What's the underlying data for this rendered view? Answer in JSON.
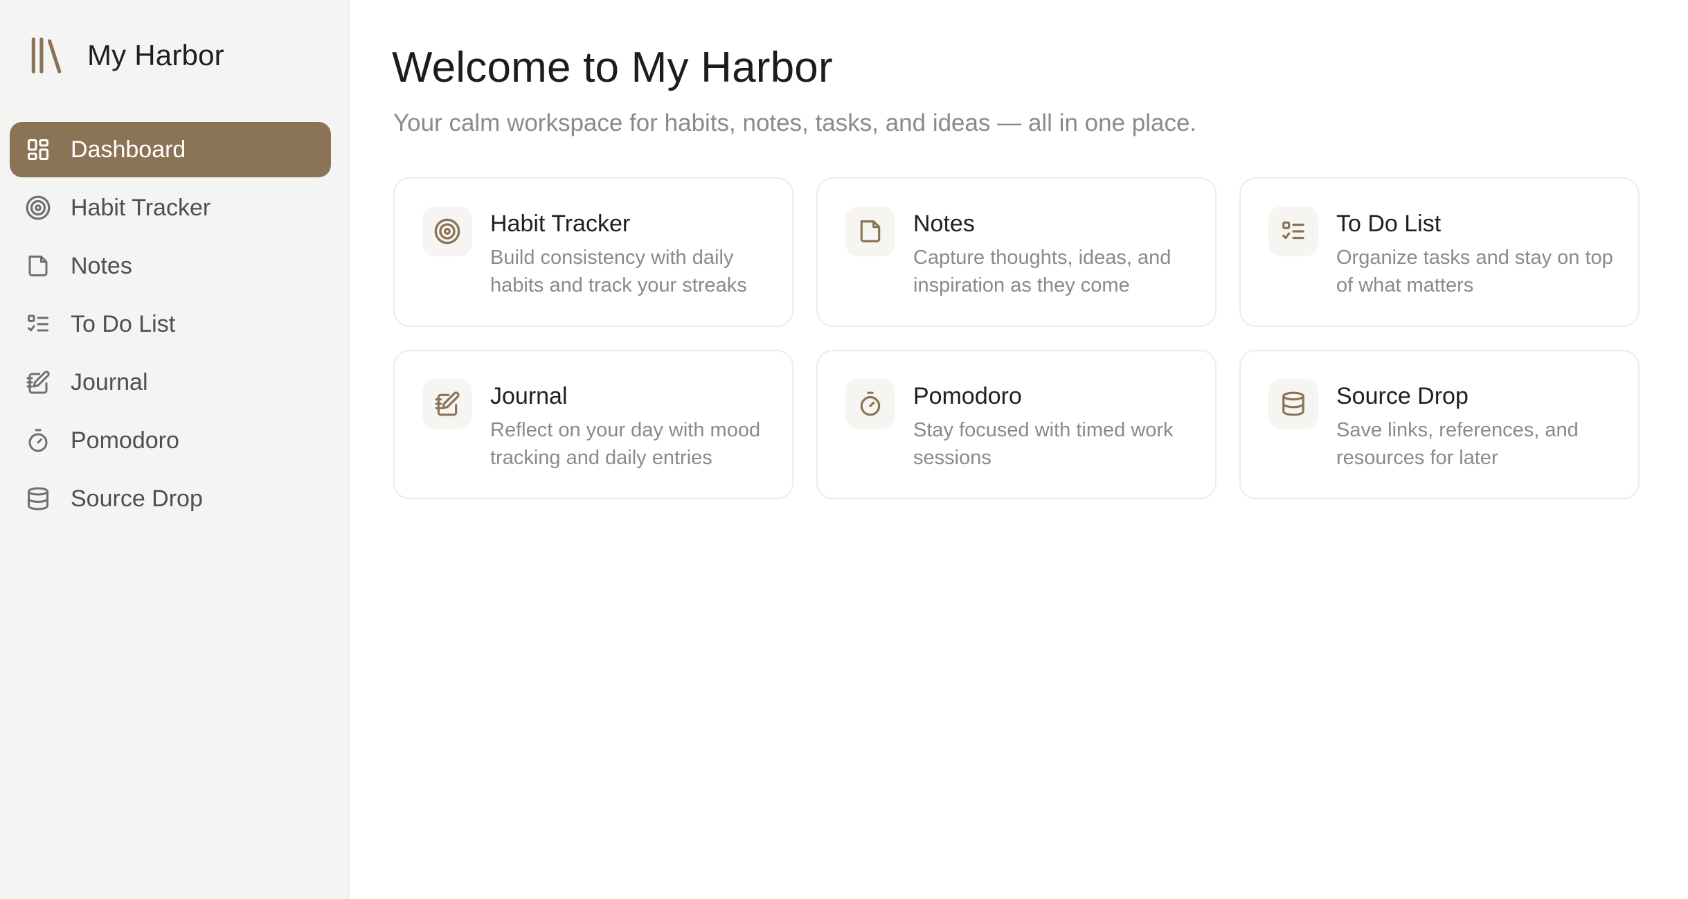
{
  "app": {
    "name": "My Harbor",
    "logo_icon": "library-icon",
    "accent_color": "#8b7455"
  },
  "sidebar": {
    "items": [
      {
        "label": "Dashboard",
        "icon": "dashboard-grid-icon",
        "active": true
      },
      {
        "label": "Habit Tracker",
        "icon": "target-icon",
        "active": false
      },
      {
        "label": "Notes",
        "icon": "note-icon",
        "active": false
      },
      {
        "label": "To Do List",
        "icon": "checklist-icon",
        "active": false
      },
      {
        "label": "Journal",
        "icon": "notebook-pen-icon",
        "active": false
      },
      {
        "label": "Pomodoro",
        "icon": "timer-icon",
        "active": false
      },
      {
        "label": "Source Drop",
        "icon": "database-icon",
        "active": false
      }
    ]
  },
  "main": {
    "title": "Welcome to My Harbor",
    "subtitle": "Your calm workspace for habits, notes, tasks, and ideas — all in one place.",
    "cards": [
      {
        "title": "Habit Tracker",
        "description": "Build consistency with daily habits and track your streaks",
        "icon": "target-icon"
      },
      {
        "title": "Notes",
        "description": "Capture thoughts, ideas, and inspiration as they come",
        "icon": "note-icon"
      },
      {
        "title": "To Do List",
        "description": "Organize tasks and stay on top of what matters",
        "icon": "checklist-icon"
      },
      {
        "title": "Journal",
        "description": "Reflect on your day with mood tracking and daily entries",
        "icon": "notebook-pen-icon"
      },
      {
        "title": "Pomodoro",
        "description": "Stay focused with timed work sessions",
        "icon": "timer-icon"
      },
      {
        "title": "Source Drop",
        "description": "Save links, references, and resources for later",
        "icon": "database-icon"
      }
    ]
  }
}
